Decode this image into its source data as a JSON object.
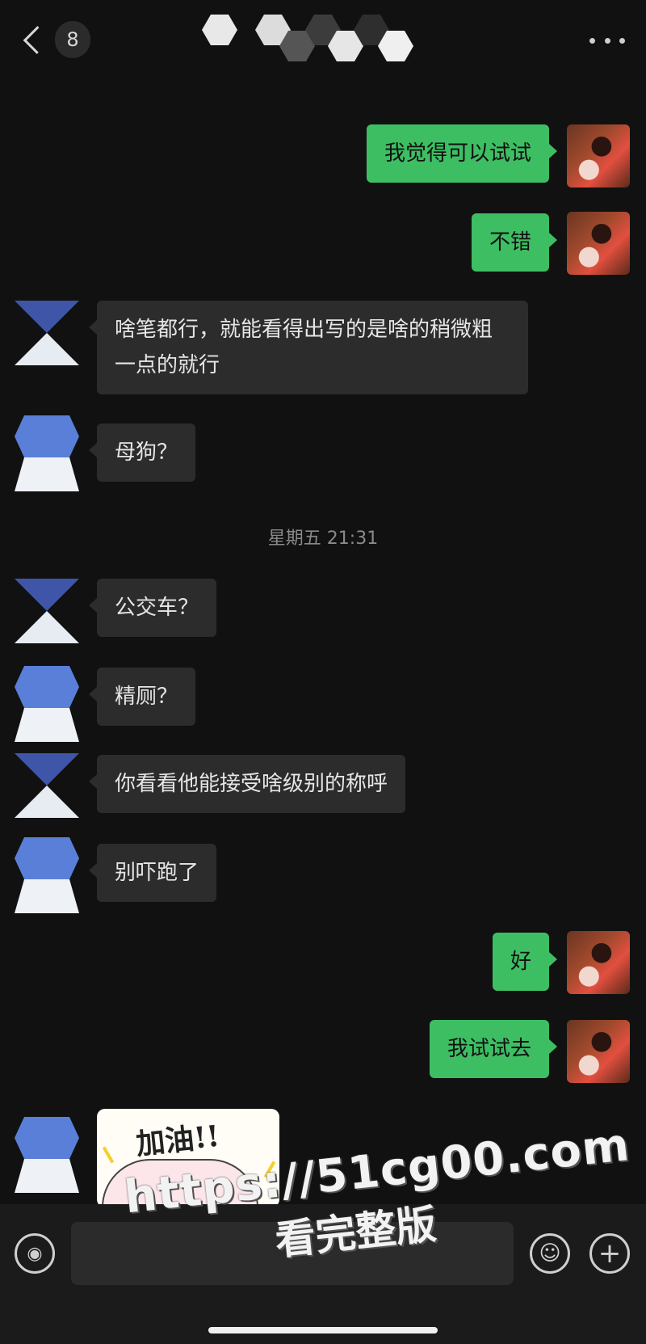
{
  "header": {
    "unread_count": "8"
  },
  "messages": [
    {
      "side": "out",
      "text": "我觉得可以试试"
    },
    {
      "side": "out",
      "text": "不错"
    },
    {
      "side": "in",
      "text": "啥笔都行，就能看得出写的是啥的稍微粗一点的就行"
    },
    {
      "side": "in",
      "text": "母狗？"
    },
    {
      "side": "in",
      "text": "公交车？"
    },
    {
      "side": "in",
      "text": "精厕？"
    },
    {
      "side": "in",
      "text": "你看看他能接受啥级别的称呼"
    },
    {
      "side": "in",
      "text": "别吓跑了"
    },
    {
      "side": "out",
      "text": "好"
    },
    {
      "side": "out",
      "text": "我试试去"
    }
  ],
  "timestamp": "星期五 21:31",
  "sticker": {
    "text": "加油!!"
  },
  "input_bar": {
    "voice_icon": "voice-icon",
    "emoji_icon": "emoji-icon",
    "plus_icon": "plus-icon"
  },
  "watermark": {
    "url": "https://51cg00.com",
    "subtitle": "看完整版"
  },
  "colors": {
    "background": "#111111",
    "outgoing_bubble": "#3ebe63",
    "incoming_bubble": "#2c2c2c"
  }
}
